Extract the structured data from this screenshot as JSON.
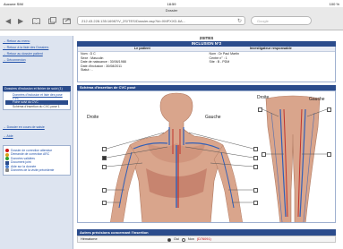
{
  "statusbar": {
    "carrier": "Aucune SIM",
    "time": "18:59",
    "battery": "100 %"
  },
  "browser": {
    "page_title": "Dossier",
    "url": "212.43.228.135:16987/V_2S/TES/Dossier.asp?Id=XMFXXD-6A...",
    "search_placeholder": "Google"
  },
  "sidebar": {
    "top_links": [
      "→ Retour au menu",
      "→ Retour à la liste des Dossiers",
      "→ Retour au dossier patient",
      "→ Déconnexion"
    ],
    "section_title": "Dossiers d'inclusion et fichier de suivi (1)",
    "section_items": [
      {
        "label": "Données d'inclusion et liste des pose CVC",
        "state": "link"
      },
      {
        "label": "Fiche suivi du CVC",
        "state": "selected"
      },
      {
        "label": "Schéma d'insertion du CVC pose 1",
        "state": "plain"
      }
    ],
    "extra_links": [
      "→ Dossier en cours de saisie",
      "→ Aide"
    ],
    "legend": [
      {
        "label": "Dossier de correction attendue",
        "color": "#d01818"
      },
      {
        "label": "Demande de correction ARC",
        "color": "#d9a21a"
      },
      {
        "label": "Données validées",
        "color": "#2f9e2f"
      },
      {
        "label": "Document joint",
        "color": "#2b4c8c"
      },
      {
        "label": "Aide sur la donnée",
        "color": "#4a7fd0"
      },
      {
        "label": "Données de la visite précédente",
        "color": "#888888"
      }
    ]
  },
  "main": {
    "study": "2SITES",
    "inclusion": "INCLUSION N°2",
    "patient_head": "Le patient",
    "investigator_head": "Investigateur responsable",
    "patient_lines": [
      "Nom : D C",
      "Sexe : Masculin",
      "Date de naissance : 30/06/1988",
      "Date d'inclusion : 30/08/2011",
      "Statut : -"
    ],
    "investigator_lines": [
      "Nom : Dr Paul Martin",
      "Centre n° : 1",
      "Site : B - PDM"
    ]
  },
  "schema": {
    "title": "Schéma d'insertion de CVC posé",
    "left_right": "Droite",
    "left_left": "Gauche",
    "right_right": "Droite",
    "right_left": "Gauche"
  },
  "precisions": {
    "title": "Autres précisions concernant l'insertion",
    "row_label": "Hématome",
    "yes_label": "Oui",
    "no_label": "Non",
    "no_warning": "(D76091)"
  },
  "colors": {
    "primary": "#2b4c8c",
    "sidebar_bg": "#dde4f0",
    "warning": "#c00000",
    "skin": "#d9a58c",
    "vein": "#2f5fb8",
    "artery": "#c0332c"
  }
}
